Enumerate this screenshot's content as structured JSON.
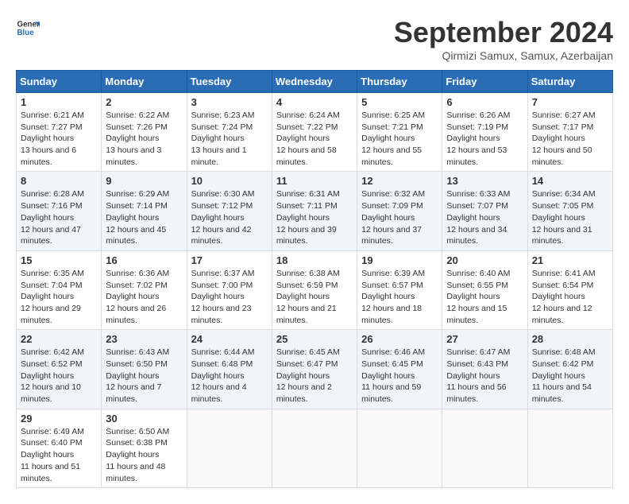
{
  "header": {
    "logo_general": "General",
    "logo_blue": "Blue",
    "month_title": "September 2024",
    "subtitle": "Qirmizi Samux, Samux, Azerbaijan"
  },
  "weekdays": [
    "Sunday",
    "Monday",
    "Tuesday",
    "Wednesday",
    "Thursday",
    "Friday",
    "Saturday"
  ],
  "weeks": [
    [
      {
        "day": "1",
        "sunrise": "6:21 AM",
        "sunset": "7:27 PM",
        "daylight": "13 hours and 6 minutes."
      },
      {
        "day": "2",
        "sunrise": "6:22 AM",
        "sunset": "7:26 PM",
        "daylight": "13 hours and 3 minutes."
      },
      {
        "day": "3",
        "sunrise": "6:23 AM",
        "sunset": "7:24 PM",
        "daylight": "13 hours and 1 minute."
      },
      {
        "day": "4",
        "sunrise": "6:24 AM",
        "sunset": "7:22 PM",
        "daylight": "12 hours and 58 minutes."
      },
      {
        "day": "5",
        "sunrise": "6:25 AM",
        "sunset": "7:21 PM",
        "daylight": "12 hours and 55 minutes."
      },
      {
        "day": "6",
        "sunrise": "6:26 AM",
        "sunset": "7:19 PM",
        "daylight": "12 hours and 53 minutes."
      },
      {
        "day": "7",
        "sunrise": "6:27 AM",
        "sunset": "7:17 PM",
        "daylight": "12 hours and 50 minutes."
      }
    ],
    [
      {
        "day": "8",
        "sunrise": "6:28 AM",
        "sunset": "7:16 PM",
        "daylight": "12 hours and 47 minutes."
      },
      {
        "day": "9",
        "sunrise": "6:29 AM",
        "sunset": "7:14 PM",
        "daylight": "12 hours and 45 minutes."
      },
      {
        "day": "10",
        "sunrise": "6:30 AM",
        "sunset": "7:12 PM",
        "daylight": "12 hours and 42 minutes."
      },
      {
        "day": "11",
        "sunrise": "6:31 AM",
        "sunset": "7:11 PM",
        "daylight": "12 hours and 39 minutes."
      },
      {
        "day": "12",
        "sunrise": "6:32 AM",
        "sunset": "7:09 PM",
        "daylight": "12 hours and 37 minutes."
      },
      {
        "day": "13",
        "sunrise": "6:33 AM",
        "sunset": "7:07 PM",
        "daylight": "12 hours and 34 minutes."
      },
      {
        "day": "14",
        "sunrise": "6:34 AM",
        "sunset": "7:05 PM",
        "daylight": "12 hours and 31 minutes."
      }
    ],
    [
      {
        "day": "15",
        "sunrise": "6:35 AM",
        "sunset": "7:04 PM",
        "daylight": "12 hours and 29 minutes."
      },
      {
        "day": "16",
        "sunrise": "6:36 AM",
        "sunset": "7:02 PM",
        "daylight": "12 hours and 26 minutes."
      },
      {
        "day": "17",
        "sunrise": "6:37 AM",
        "sunset": "7:00 PM",
        "daylight": "12 hours and 23 minutes."
      },
      {
        "day": "18",
        "sunrise": "6:38 AM",
        "sunset": "6:59 PM",
        "daylight": "12 hours and 21 minutes."
      },
      {
        "day": "19",
        "sunrise": "6:39 AM",
        "sunset": "6:57 PM",
        "daylight": "12 hours and 18 minutes."
      },
      {
        "day": "20",
        "sunrise": "6:40 AM",
        "sunset": "6:55 PM",
        "daylight": "12 hours and 15 minutes."
      },
      {
        "day": "21",
        "sunrise": "6:41 AM",
        "sunset": "6:54 PM",
        "daylight": "12 hours and 12 minutes."
      }
    ],
    [
      {
        "day": "22",
        "sunrise": "6:42 AM",
        "sunset": "6:52 PM",
        "daylight": "12 hours and 10 minutes."
      },
      {
        "day": "23",
        "sunrise": "6:43 AM",
        "sunset": "6:50 PM",
        "daylight": "12 hours and 7 minutes."
      },
      {
        "day": "24",
        "sunrise": "6:44 AM",
        "sunset": "6:48 PM",
        "daylight": "12 hours and 4 minutes."
      },
      {
        "day": "25",
        "sunrise": "6:45 AM",
        "sunset": "6:47 PM",
        "daylight": "12 hours and 2 minutes."
      },
      {
        "day": "26",
        "sunrise": "6:46 AM",
        "sunset": "6:45 PM",
        "daylight": "11 hours and 59 minutes."
      },
      {
        "day": "27",
        "sunrise": "6:47 AM",
        "sunset": "6:43 PM",
        "daylight": "11 hours and 56 minutes."
      },
      {
        "day": "28",
        "sunrise": "6:48 AM",
        "sunset": "6:42 PM",
        "daylight": "11 hours and 54 minutes."
      }
    ],
    [
      {
        "day": "29",
        "sunrise": "6:49 AM",
        "sunset": "6:40 PM",
        "daylight": "11 hours and 51 minutes."
      },
      {
        "day": "30",
        "sunrise": "6:50 AM",
        "sunset": "6:38 PM",
        "daylight": "11 hours and 48 minutes."
      },
      null,
      null,
      null,
      null,
      null
    ]
  ]
}
